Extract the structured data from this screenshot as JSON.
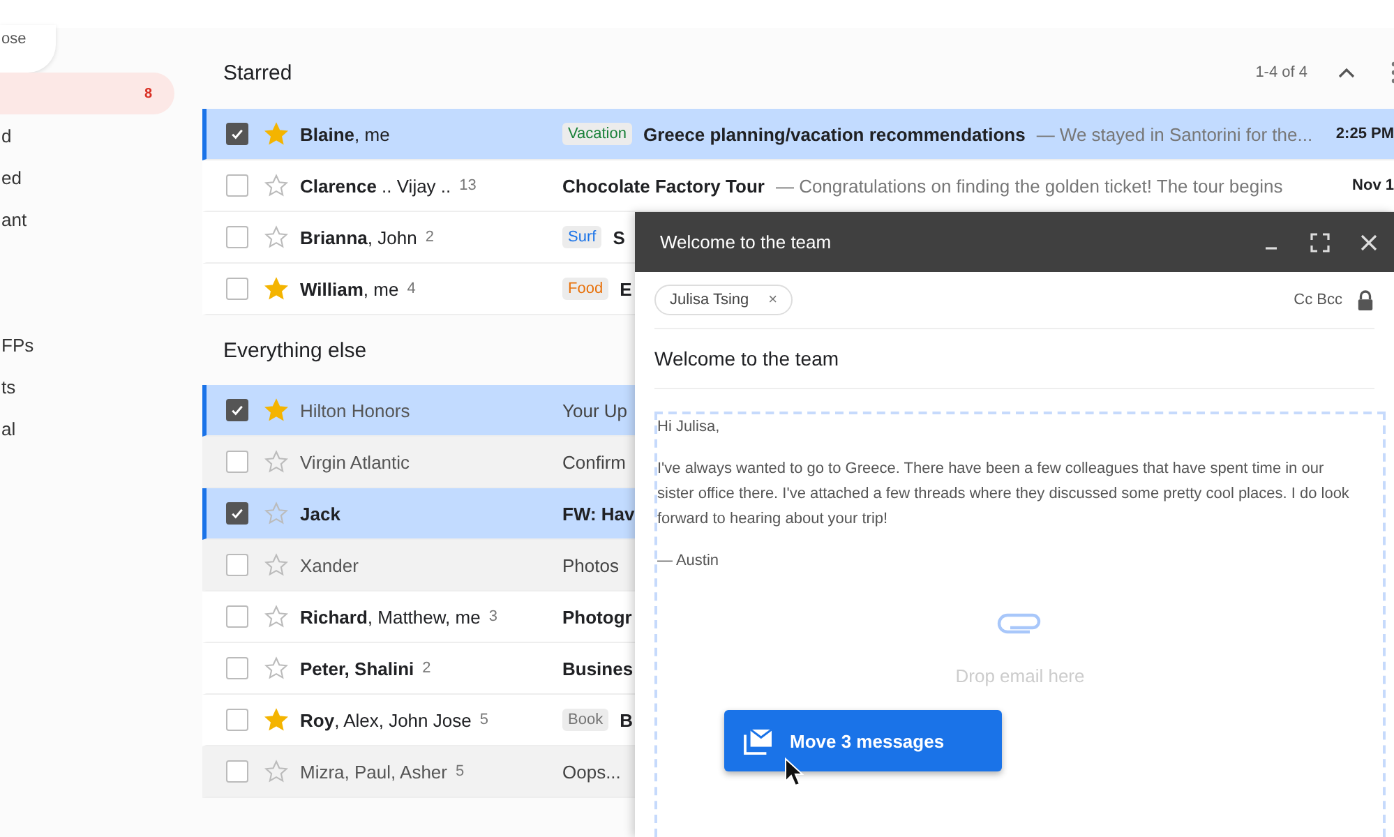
{
  "sidebar": {
    "compose_label": "ose",
    "sections": [
      [
        {
          "count": "8",
          "selected": true
        },
        {
          "label": "d",
          "selected": false
        },
        {
          "label": "ed",
          "selected": false
        },
        {
          "label": "ant",
          "selected": false
        }
      ],
      [
        {
          "label": "FPs",
          "selected": false
        },
        {
          "label": "ts",
          "selected": false
        },
        {
          "label": "al",
          "selected": false
        }
      ]
    ]
  },
  "pagination": {
    "range": "1-4 of 4"
  },
  "sections": [
    {
      "title": "Starred",
      "rows": [
        {
          "selected": true,
          "starred": true,
          "unread": true,
          "sender": "**Blaine**, me",
          "tag": {
            "text": "Vacation",
            "color": "#188038"
          },
          "subject": "Greece planning/vacation recommendations",
          "snippet": "— We stayed in Santorini for the...",
          "date": "2:25 PM"
        },
        {
          "selected": false,
          "starred": false,
          "unread": true,
          "sender": "**Clarence** .. Vijay ..",
          "count": "13",
          "subject": "Chocolate Factory Tour",
          "snippet": "— Congratulations on finding the golden ticket! The tour begins",
          "date": "Nov 1"
        },
        {
          "selected": false,
          "starred": false,
          "unread": true,
          "sender": "**Brianna**, John",
          "count": "2",
          "tag": {
            "text": "Surf",
            "color": "#1a73e8"
          },
          "subject": "S"
        },
        {
          "selected": false,
          "starred": true,
          "unread": true,
          "sender": "**William**, me",
          "count": "4",
          "tag": {
            "text": "Food",
            "color": "#e8710a"
          },
          "subject": "E"
        }
      ]
    },
    {
      "title": "Everything else",
      "rows": [
        {
          "selected": true,
          "starred": true,
          "unread": false,
          "sender": "Hilton Honors",
          "subject": "Your Up"
        },
        {
          "selected": false,
          "starred": false,
          "unread": false,
          "sender": "Virgin Atlantic",
          "subject": "Confirm"
        },
        {
          "selected": true,
          "starred": false,
          "unread": true,
          "sender": "**Jack**",
          "subject": "FW: Hav"
        },
        {
          "selected": false,
          "starred": false,
          "unread": false,
          "sender": "Xander",
          "subject": "Photos"
        },
        {
          "selected": false,
          "starred": false,
          "unread": true,
          "sender": "**Richard**, Matthew, me",
          "count": "3",
          "subject": "Photogr"
        },
        {
          "selected": false,
          "starred": false,
          "unread": true,
          "sender": "**Peter, Shalini**",
          "count": "2",
          "subject": "Busines"
        },
        {
          "selected": false,
          "starred": true,
          "unread": true,
          "sender": "**Roy**, Alex, John Jose",
          "count": "5",
          "tag": {
            "text": "Book",
            "color": "#757575"
          },
          "subject": "B"
        },
        {
          "selected": false,
          "starred": false,
          "unread": false,
          "sender": "Mizra, Paul, Asher",
          "count": "5",
          "subject": "Oops..."
        }
      ]
    }
  ],
  "compose": {
    "title": "Welcome to the team",
    "recipient": "Julisa Tsing",
    "remove_glyph": "×",
    "cc_bcc": "Cc Bcc",
    "subject": "Welcome to the team",
    "body": [
      "Hi Julisa,",
      "I've always wanted to go to Greece. There have been a few colleagues that have spent time in our sister office there. I've attached a few threads where they discussed some pretty cool places. I do look forward to hearing about your trip!",
      "— Austin"
    ],
    "drop_hint": "Drop email here"
  },
  "drag_chip": {
    "label": "Move 3 messages"
  }
}
